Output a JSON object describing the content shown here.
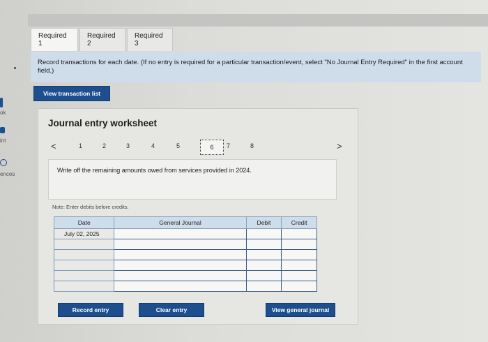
{
  "tabs": [
    {
      "label": "Required 1"
    },
    {
      "label": "Required 2"
    },
    {
      "label": "Required 3"
    }
  ],
  "instruction": "Record transactions for each date. (If no entry is required for a particular transaction/event, select \"No Journal Entry Required\" in the first account field.)",
  "view_transaction_list": "View transaction list",
  "left_rail": {
    "item1": "ok",
    "item2": "int",
    "item3": "ences"
  },
  "worksheet": {
    "title": "Journal entry worksheet",
    "pages": [
      "1",
      "2",
      "3",
      "4",
      "5",
      "6",
      "7",
      "8"
    ],
    "active_page": "6",
    "prev": "<",
    "next": ">",
    "description": "Write off the remaining amounts owed from services provided in 2024.",
    "note": "Note: Enter debits before credits.",
    "table": {
      "headers": [
        "Date",
        "General Journal",
        "Debit",
        "Credit"
      ],
      "date": "July 02, 2025"
    },
    "record_entry": "Record entry",
    "clear_entry": "Clear entry",
    "view_general_journal": "View general journal"
  },
  "colors": {
    "accent": "#1d4f8f",
    "instruction_bg": "#cfdcea"
  }
}
